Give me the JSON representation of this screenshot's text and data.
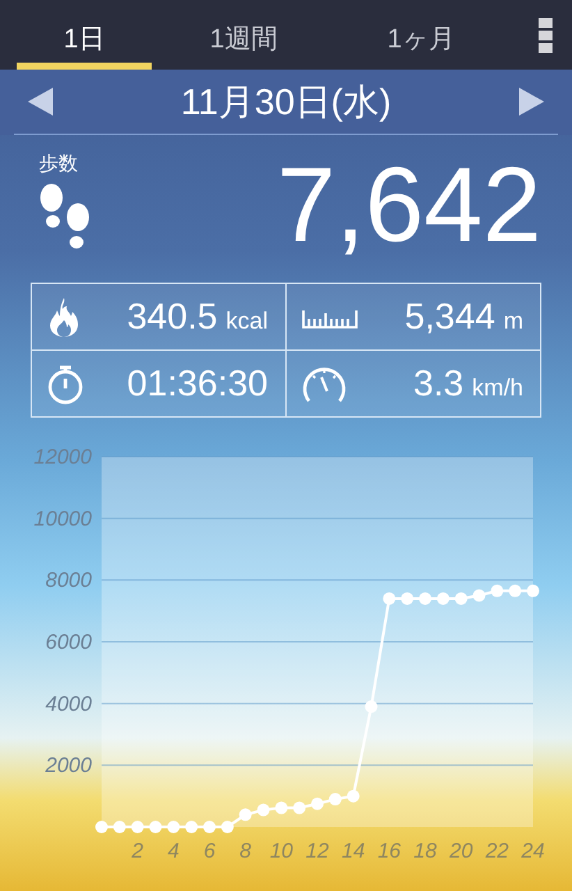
{
  "tabs": [
    {
      "label": "1日",
      "selected": true
    },
    {
      "label": "1週間",
      "selected": false
    },
    {
      "label": "1ヶ月",
      "selected": false
    }
  ],
  "date_nav": {
    "date": "11月30日(水)"
  },
  "steps": {
    "label": "歩数",
    "value": "7,642"
  },
  "stats": [
    {
      "kind": "calories",
      "value": "340.5",
      "unit": "kcal"
    },
    {
      "kind": "distance",
      "value": "5,344",
      "unit": "m"
    },
    {
      "kind": "time",
      "value": "01:36:30"
    },
    {
      "kind": "speed",
      "value": "3.3",
      "unit": "km/h"
    }
  ],
  "chart": {
    "chart_data": {
      "type": "line",
      "x": [
        0,
        1,
        2,
        3,
        4,
        5,
        6,
        7,
        8,
        9,
        10,
        11,
        12,
        13,
        14,
        15,
        16,
        17,
        18,
        19,
        20,
        21,
        22,
        23,
        24
      ],
      "grid": true,
      "series": [
        {
          "color": "#ffffff",
          "marker": "circle",
          "values": [
            0,
            0,
            0,
            0,
            0,
            0,
            0,
            0,
            400,
            550,
            620,
            620,
            750,
            900,
            1000,
            3900,
            7400,
            7400,
            7400,
            7400,
            7400,
            7500,
            7650,
            7650,
            7650
          ]
        }
      ],
      "xlim": [
        0,
        24
      ],
      "ylim": [
        0,
        12000
      ],
      "xticks": [
        2,
        4,
        6,
        8,
        10,
        12,
        14,
        16,
        18,
        20,
        22,
        24
      ],
      "yticks": [
        2000,
        4000,
        6000,
        8000,
        10000,
        12000
      ]
    }
  }
}
